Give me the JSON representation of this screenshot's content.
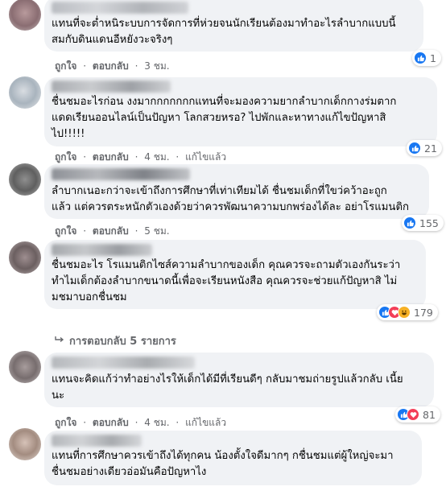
{
  "actions": {
    "like": "ถูกใจ",
    "reply": "ตอบกลับ",
    "sep": "·",
    "edited": "แก้ไขแล้ว"
  },
  "comments": [
    {
      "text": "แทนที่จะต่ำหนิระบบการจัดการที่ห่วยจนนักเรียนต้องมาทำอะไรลำบากแบบนี้\nสมกับดินแดนอีหยังวะจริงๆ",
      "time": "3 ชม.",
      "reaction_count": "1",
      "reactions": [
        "like"
      ]
    },
    {
      "text": "ชื่นชมอะไรก่อน งงมากกกกกกกแทนที่จะมองความยากลำบากเด็กกางร่มตาก\nแดดเรียนออนไลน์เป็นปัญหา โลกสวยหรอ? ไปพักและหาทางแก้ไขปัญหาสิ\nไป!!!!!",
      "time": "4 ชม.",
      "edited": true,
      "reaction_count": "21",
      "reactions": [
        "like"
      ]
    },
    {
      "text": "ลำบากเนอะกว่าจะเข้าถึงการศึกษาที่เท่าเทียมได้ ชื่นชมเด็กที่ใขว่คว้าอะถูก\nแล้ว แต่ควรตระหนักตัวเองด้วยว่าควรพัฒนาความบกพร่องได้ละ อย่าโรแมนติก",
      "time": "5 ชม.",
      "reaction_count": "155",
      "reactions": [
        "like"
      ]
    },
    {
      "text": "ชื่นชมอะไร โรแมนติกไซส์ความลำบากของเด็ก คุณควรจะถามตัวเองกันระว่า\nทำไมเด็กต้องลำบากขนาดนี้เพื่อจะเรียนหนังสือ คุณควรจะช่วยแก้ปัญหาสิ ไม่\nมชมาบอกชื่นชม",
      "time": "5 ชม.",
      "reaction_count": "179",
      "reactions": [
        "like",
        "love",
        "haha"
      ]
    },
    {
      "text": "แทนจะคิดแก้ว่าทำอย่างไรให้เด็กได้มีที่เรียนดีๆ กลับมาชมถ่ายรูปแล้วกลับ เนี้ย\nนะ",
      "time": "4 ชม.",
      "edited": true,
      "reaction_count": "81",
      "reactions": [
        "like",
        "love"
      ]
    },
    {
      "text": "แทนที่การศึกษาควรเข้าถึงได้ทุกคน น้องตั้งใจดีมากๆ กชื่นชมแต่ผู้ใหญ่จะมา\nชื่นชมอย่างเดียวอ่อมันคือปัญหาไง"
    }
  ],
  "view_replies": "การตอบกลับ 5 รายการ",
  "icons": {
    "like": "thumbs-up-icon",
    "love": "heart-icon",
    "haha": "haha-icon",
    "reply_arrow": "reply-arrow-icon"
  },
  "colors": {
    "like": "#1877f2",
    "love": "#f33e58",
    "haha": "#f7b125",
    "bubble": "#f0f2f5",
    "meta": "#65676b"
  }
}
